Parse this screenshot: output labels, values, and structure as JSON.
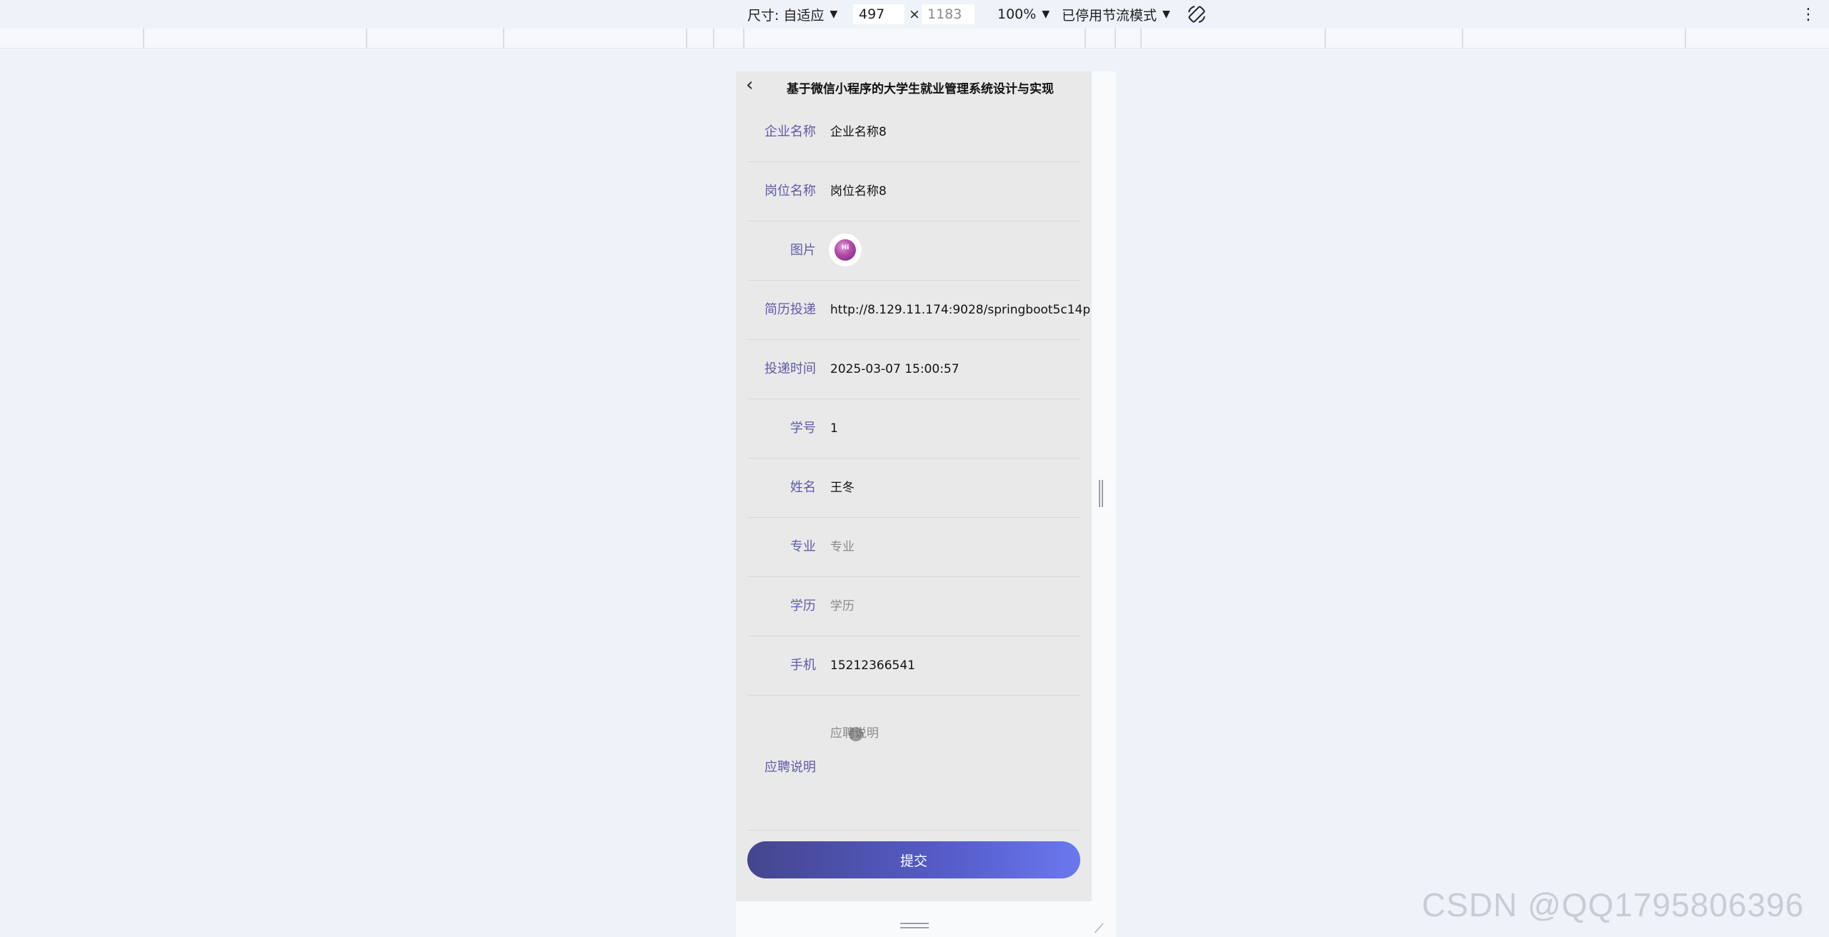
{
  "devtools": {
    "dimensions_label": "尺寸: 自适应",
    "width_value": "497",
    "times": "×",
    "height_value": "1183",
    "zoom": "100%",
    "throttling": "已停用节流模式",
    "more_icon": "⋮"
  },
  "nav": {
    "back_icon": "‹",
    "title": "基于微信小程序的大学生就业管理系统设计与实现"
  },
  "form": {
    "fields": [
      {
        "label": "企业名称",
        "value": "企业名称8"
      },
      {
        "label": "岗位名称",
        "value": "岗位名称8"
      },
      {
        "label": "图片",
        "value": ""
      },
      {
        "label": "简历投递",
        "value": "http://8.129.11.174:9028/springboot5c14p"
      },
      {
        "label": "投递时间",
        "value": "2025-03-07 15:00:57"
      },
      {
        "label": "学号",
        "value": "1"
      },
      {
        "label": "姓名",
        "value": "王冬"
      },
      {
        "label": "专业",
        "placeholder": "专业"
      },
      {
        "label": "学历",
        "placeholder": "学历"
      },
      {
        "label": "手机",
        "value": "15212366541"
      }
    ],
    "avatar_text": "Hi",
    "description": {
      "label": "应聘说明",
      "placeholder": "应聘说明"
    },
    "submit_label": "提交"
  },
  "watermark": "CSDN @QQ1795806396",
  "colors": {
    "label": "#5f5ba8",
    "button_start": "#44468e",
    "button_end": "#6a78ef",
    "page_bg": "#eef2f9"
  }
}
